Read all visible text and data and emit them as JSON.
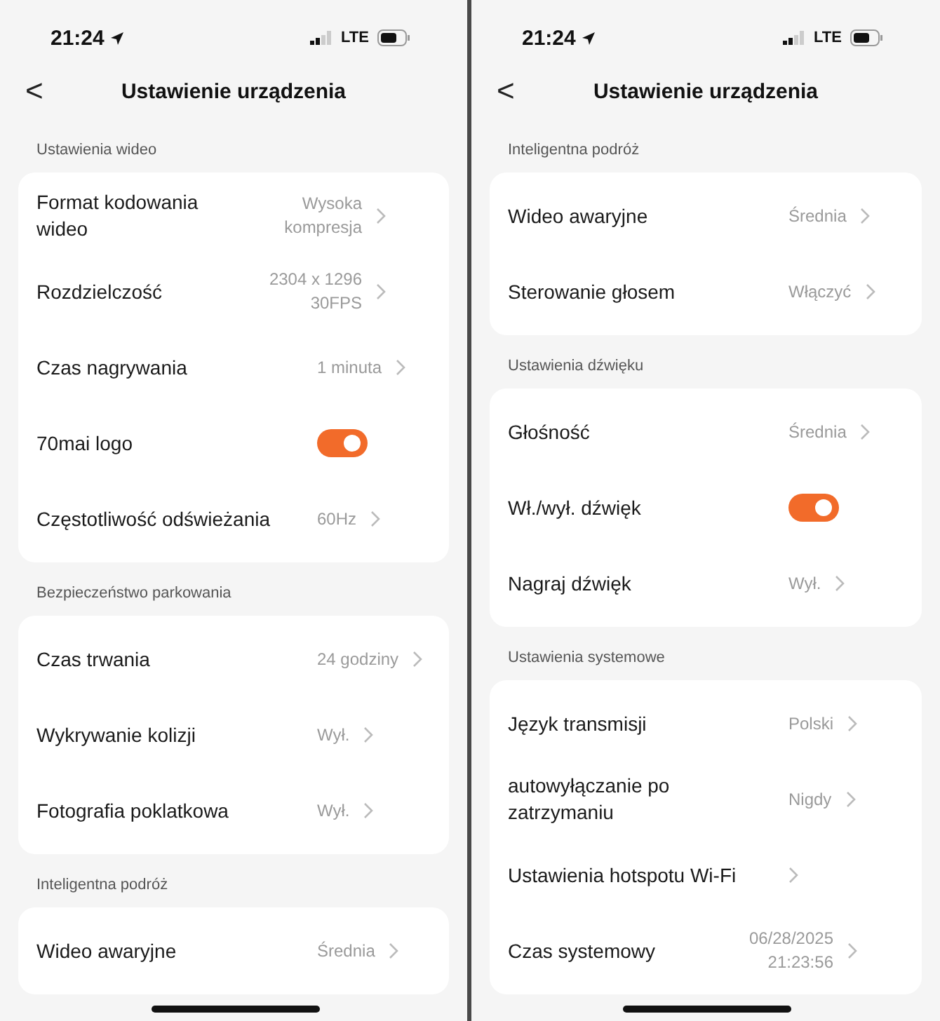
{
  "screens": [
    {
      "status_bar": {
        "time": "21:24",
        "network": "LTE"
      },
      "nav": {
        "back": "<",
        "title": "Ustawienie urządzenia"
      },
      "sections": [
        {
          "header": "Ustawienia wideo",
          "rows": [
            {
              "kind": "value",
              "label": "Format kodowania wideo",
              "value": "Wysoka kompresja"
            },
            {
              "kind": "value",
              "label": "Rozdzielczość",
              "value": "2304 x 1296 30FPS"
            },
            {
              "kind": "value",
              "label": "Czas nagrywania",
              "value": "1 minuta"
            },
            {
              "kind": "toggle",
              "label": "70mai logo",
              "on": true
            },
            {
              "kind": "value",
              "label": "Częstotliwość odświeżania",
              "value": "60Hz"
            }
          ]
        },
        {
          "header": "Bezpieczeństwo parkowania",
          "rows": [
            {
              "kind": "value",
              "label": "Czas trwania",
              "value": "24 godziny"
            },
            {
              "kind": "value",
              "label": "Wykrywanie kolizji",
              "value": "Wył."
            },
            {
              "kind": "value",
              "label": "Fotografia poklatkowa",
              "value": "Wył."
            }
          ]
        },
        {
          "header": "Inteligentna podróż",
          "rows": [
            {
              "kind": "value",
              "label": "Wideo awaryjne",
              "value": "Średnia"
            }
          ]
        }
      ]
    },
    {
      "status_bar": {
        "time": "21:24",
        "network": "LTE"
      },
      "nav": {
        "back": "<",
        "title": "Ustawienie urządzenia"
      },
      "sections": [
        {
          "header": "Inteligentna podróż",
          "rows": [
            {
              "kind": "value",
              "label": "Wideo awaryjne",
              "value": "Średnia"
            },
            {
              "kind": "value",
              "label": "Sterowanie głosem",
              "value": "Włączyć"
            }
          ]
        },
        {
          "header": "Ustawienia dźwięku",
          "rows": [
            {
              "kind": "value",
              "label": "Głośność",
              "value": "Średnia"
            },
            {
              "kind": "toggle",
              "label": "Wł./wył. dźwięk",
              "on": true
            },
            {
              "kind": "value",
              "label": "Nagraj dźwięk",
              "value": "Wył."
            }
          ]
        },
        {
          "header": "Ustawienia systemowe",
          "rows": [
            {
              "kind": "value",
              "label": "Język transmisji",
              "value": "Polski"
            },
            {
              "kind": "value",
              "label": "autowyłączanie po zatrzymaniu",
              "value": "Nigdy"
            },
            {
              "kind": "link",
              "label": "Ustawienia hotspotu Wi-Fi"
            },
            {
              "kind": "value",
              "label": "Czas systemowy",
              "value": "06/28/2025 21:23:56"
            }
          ]
        }
      ]
    }
  ]
}
